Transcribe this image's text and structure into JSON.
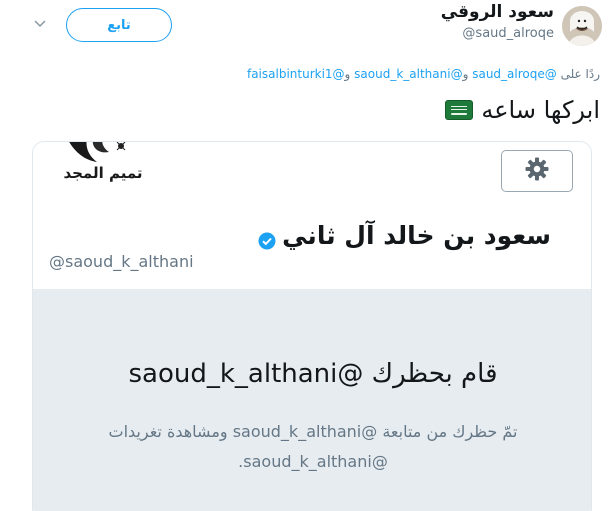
{
  "tweet": {
    "author_name": "سعود الروقي",
    "author_handle": "@saud_alroqe",
    "follow_label": "تابع",
    "reply_prefix": "ردًا على",
    "reply_mentions": [
      "@saud_alroqe",
      "@saoud_k_althani",
      "@faisalbinturki1"
    ],
    "reply_and": "و",
    "text": "ابركها ساعه",
    "flag_icon": "saudi-flag-emoji"
  },
  "embed": {
    "banner_logo_text": "تميم المجد",
    "settings_icon": "gear-icon",
    "profile_name": "سعود بن خالد آل ثاني",
    "profile_handle": "@saoud_k_althani",
    "blocked_title": "قام بحظرك @saoud_k_althani",
    "blocked_desc": "تمّ حظرك من متابعة @saoud_k_althani ومشاهدة تغريدات @saoud_k_althani."
  },
  "colors": {
    "accent": "#1da1f2",
    "panel_bg": "#e6ecf0",
    "muted_text": "#657786"
  }
}
